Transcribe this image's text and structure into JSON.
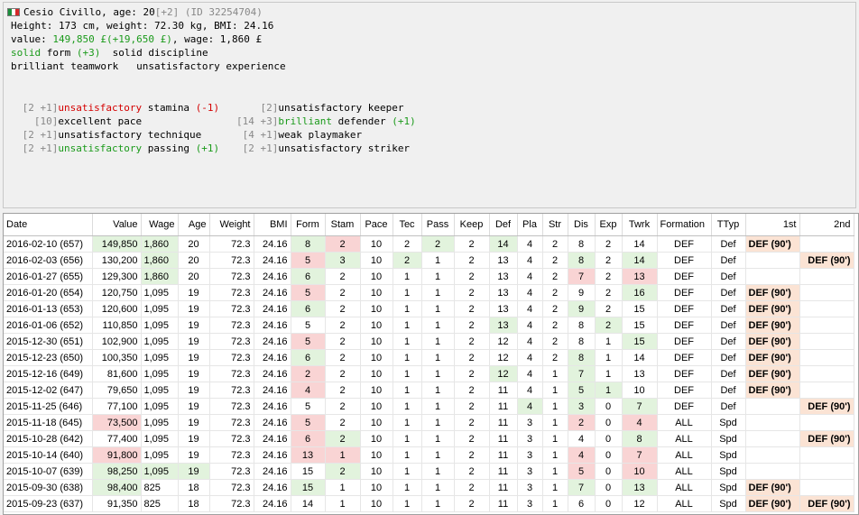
{
  "player": {
    "name_line": "Cesio Civillo, age: 20",
    "age_diff": "[+2]",
    "id": "(ID 32254704)",
    "body": "Height: 173 cm, weight: 72.30 kg, BMI: 24.16",
    "value_prefix": "value: ",
    "value": "149,850 £",
    "value_diff": "(+19,650 £)",
    "wage": ", wage: 1,860 £",
    "form_word": "solid",
    "form_rest": " form ",
    "form_diff": "(+3)",
    "discipline": "  solid discipline",
    "traits": "brilliant teamwork   unsatisfactory experience"
  },
  "skills": [
    {
      "prefix": " [2 +1]",
      "level": "unsatisfactory",
      "level_color": "red",
      "name": " stamina ",
      "diff": "(-1)",
      "diff_color": "red"
    },
    {
      "prefix": "   [10]",
      "level": "excellent",
      "level_color": "black",
      "name": " pace",
      "diff": "",
      "diff_color": "black"
    },
    {
      "prefix": " [2 +1]",
      "level": "unsatisfactory",
      "level_color": "black",
      "name": " technique",
      "diff": "",
      "diff_color": "black"
    },
    {
      "prefix": " [2 +1]",
      "level": "unsatisfactory",
      "level_color": "green",
      "name": " passing ",
      "diff": "(+1)",
      "diff_color": "green"
    },
    {
      "prefix": "    [2]",
      "level": "unsatisfactory",
      "level_color": "black",
      "name": " keeper",
      "diff": "",
      "diff_color": "black"
    },
    {
      "prefix": "[14 +3]",
      "level": "brilliant",
      "level_color": "green",
      "name": " defender ",
      "diff": "(+1)",
      "diff_color": "green"
    },
    {
      "prefix": " [4 +1]",
      "level": "weak",
      "level_color": "black",
      "name": " playmaker",
      "diff": "",
      "diff_color": "black"
    },
    {
      "prefix": " [2 +1]",
      "level": "unsatisfactory",
      "level_color": "black",
      "name": " striker",
      "diff": "",
      "diff_color": "black"
    }
  ],
  "columns": [
    "Date",
    "Value",
    "Wage",
    "Age",
    "Weight",
    "BMI",
    "Form",
    "Stam",
    "Pace",
    "Tec",
    "Pass",
    "Keep",
    "Def",
    "Pla",
    "Str",
    "Dis",
    "Exp",
    "Twrk",
    "Formation",
    "TTyp",
    "1st",
    "2nd"
  ],
  "rows": [
    {
      "cells": [
        "2016-02-10 (657)",
        "149,850",
        "1,860",
        "20",
        "72.3",
        "24.16",
        "8",
        "2",
        "10",
        "2",
        "2",
        "2",
        "14",
        "4",
        "2",
        "8",
        "2",
        "14",
        "DEF",
        "Def",
        "DEF (90')",
        ""
      ],
      "hl": {
        "1": "g",
        "2": "g",
        "6": "g",
        "7": "r",
        "10": "g",
        "12": "g",
        "20": "o"
      }
    },
    {
      "cells": [
        "2016-02-03 (656)",
        "130,200",
        "1,860",
        "20",
        "72.3",
        "24.16",
        "5",
        "3",
        "10",
        "2",
        "1",
        "2",
        "13",
        "4",
        "2",
        "8",
        "2",
        "14",
        "DEF",
        "Def",
        "",
        "DEF (90')"
      ],
      "hl": {
        "2": "g",
        "6": "r",
        "7": "g",
        "9": "g",
        "15": "g",
        "17": "g",
        "21": "o"
      }
    },
    {
      "cells": [
        "2016-01-27 (655)",
        "129,300",
        "1,860",
        "20",
        "72.3",
        "24.16",
        "6",
        "2",
        "10",
        "1",
        "1",
        "2",
        "13",
        "4",
        "2",
        "7",
        "2",
        "13",
        "DEF",
        "Def",
        "",
        ""
      ],
      "hl": {
        "2": "g",
        "6": "g",
        "15": "r",
        "17": "r"
      }
    },
    {
      "cells": [
        "2016-01-20 (654)",
        "120,750",
        "1,095",
        "19",
        "72.3",
        "24.16",
        "5",
        "2",
        "10",
        "1",
        "1",
        "2",
        "13",
        "4",
        "2",
        "9",
        "2",
        "16",
        "DEF",
        "Def",
        "DEF (90')",
        ""
      ],
      "hl": {
        "6": "r",
        "17": "g",
        "20": "o"
      }
    },
    {
      "cells": [
        "2016-01-13 (653)",
        "120,600",
        "1,095",
        "19",
        "72.3",
        "24.16",
        "6",
        "2",
        "10",
        "1",
        "1",
        "2",
        "13",
        "4",
        "2",
        "9",
        "2",
        "15",
        "DEF",
        "Def",
        "DEF (90')",
        ""
      ],
      "hl": {
        "6": "g",
        "15": "g",
        "20": "o"
      }
    },
    {
      "cells": [
        "2016-01-06 (652)",
        "110,850",
        "1,095",
        "19",
        "72.3",
        "24.16",
        "5",
        "2",
        "10",
        "1",
        "1",
        "2",
        "13",
        "4",
        "2",
        "8",
        "2",
        "15",
        "DEF",
        "Def",
        "DEF (90')",
        ""
      ],
      "hl": {
        "12": "g",
        "16": "g",
        "20": "o"
      }
    },
    {
      "cells": [
        "2015-12-30 (651)",
        "102,900",
        "1,095",
        "19",
        "72.3",
        "24.16",
        "5",
        "2",
        "10",
        "1",
        "1",
        "2",
        "12",
        "4",
        "2",
        "8",
        "1",
        "15",
        "DEF",
        "Def",
        "DEF (90')",
        ""
      ],
      "hl": {
        "6": "r",
        "17": "g",
        "20": "o"
      }
    },
    {
      "cells": [
        "2015-12-23 (650)",
        "100,350",
        "1,095",
        "19",
        "72.3",
        "24.16",
        "6",
        "2",
        "10",
        "1",
        "1",
        "2",
        "12",
        "4",
        "2",
        "8",
        "1",
        "14",
        "DEF",
        "Def",
        "DEF (90')",
        ""
      ],
      "hl": {
        "6": "g",
        "15": "g",
        "20": "o"
      }
    },
    {
      "cells": [
        "2015-12-16 (649)",
        "81,600",
        "1,095",
        "19",
        "72.3",
        "24.16",
        "2",
        "2",
        "10",
        "1",
        "1",
        "2",
        "12",
        "4",
        "1",
        "7",
        "1",
        "13",
        "DEF",
        "Def",
        "DEF (90')",
        ""
      ],
      "hl": {
        "6": "r",
        "12": "g",
        "15": "g",
        "20": "o"
      }
    },
    {
      "cells": [
        "2015-12-02 (647)",
        "79,650",
        "1,095",
        "19",
        "72.3",
        "24.16",
        "4",
        "2",
        "10",
        "1",
        "1",
        "2",
        "11",
        "4",
        "1",
        "5",
        "1",
        "10",
        "DEF",
        "Def",
        "DEF (90')",
        ""
      ],
      "hl": {
        "6": "r",
        "15": "g",
        "16": "g",
        "20": "o"
      }
    },
    {
      "cells": [
        "2015-11-25 (646)",
        "77,100",
        "1,095",
        "19",
        "72.3",
        "24.16",
        "5",
        "2",
        "10",
        "1",
        "1",
        "2",
        "11",
        "4",
        "1",
        "3",
        "0",
        "7",
        "DEF",
        "Def",
        "",
        "DEF (90')"
      ],
      "hl": {
        "13": "g",
        "15": "g",
        "17": "g",
        "21": "o"
      }
    },
    {
      "cells": [
        "2015-11-18 (645)",
        "73,500",
        "1,095",
        "19",
        "72.3",
        "24.16",
        "5",
        "2",
        "10",
        "1",
        "1",
        "2",
        "11",
        "3",
        "1",
        "2",
        "0",
        "4",
        "ALL",
        "Spd",
        "",
        ""
      ],
      "hl": {
        "1": "r",
        "6": "r",
        "15": "r",
        "17": "r"
      }
    },
    {
      "cells": [
        "2015-10-28 (642)",
        "77,400",
        "1,095",
        "19",
        "72.3",
        "24.16",
        "6",
        "2",
        "10",
        "1",
        "1",
        "2",
        "11",
        "3",
        "1",
        "4",
        "0",
        "8",
        "ALL",
        "Spd",
        "",
        "DEF (90')"
      ],
      "hl": {
        "6": "r",
        "7": "g",
        "17": "g",
        "21": "o"
      }
    },
    {
      "cells": [
        "2015-10-14 (640)",
        "91,800",
        "1,095",
        "19",
        "72.3",
        "24.16",
        "13",
        "1",
        "10",
        "1",
        "1",
        "2",
        "11",
        "3",
        "1",
        "4",
        "0",
        "7",
        "ALL",
        "Spd",
        "",
        ""
      ],
      "hl": {
        "1": "r",
        "6": "r",
        "7": "r",
        "15": "r",
        "17": "r"
      }
    },
    {
      "cells": [
        "2015-10-07 (639)",
        "98,250",
        "1,095",
        "19",
        "72.3",
        "24.16",
        "15",
        "2",
        "10",
        "1",
        "1",
        "2",
        "11",
        "3",
        "1",
        "5",
        "0",
        "10",
        "ALL",
        "Spd",
        "",
        ""
      ],
      "hl": {
        "1": "g",
        "2": "g",
        "3": "g",
        "7": "g",
        "15": "r",
        "17": "r"
      }
    },
    {
      "cells": [
        "2015-09-30 (638)",
        "98,400",
        "825",
        "18",
        "72.3",
        "24.16",
        "15",
        "1",
        "10",
        "1",
        "1",
        "2",
        "11",
        "3",
        "1",
        "7",
        "0",
        "13",
        "ALL",
        "Spd",
        "DEF (90')",
        ""
      ],
      "hl": {
        "1": "g",
        "6": "g",
        "15": "g",
        "17": "g",
        "20": "o"
      }
    },
    {
      "cells": [
        "2015-09-23 (637)",
        "91,350",
        "825",
        "18",
        "72.3",
        "24.16",
        "14",
        "1",
        "10",
        "1",
        "1",
        "2",
        "11",
        "3",
        "1",
        "6",
        "0",
        "12",
        "ALL",
        "Spd",
        "DEF (90')",
        "DEF (90')"
      ],
      "hl": {
        "20": "o",
        "21": "o"
      }
    }
  ],
  "colors": {
    "green_text": "#1a9a1a",
    "red_text": "#d40000",
    "good": "#e2f3dd",
    "bad": "#f9d4d4",
    "match": "#fbe3d4"
  }
}
